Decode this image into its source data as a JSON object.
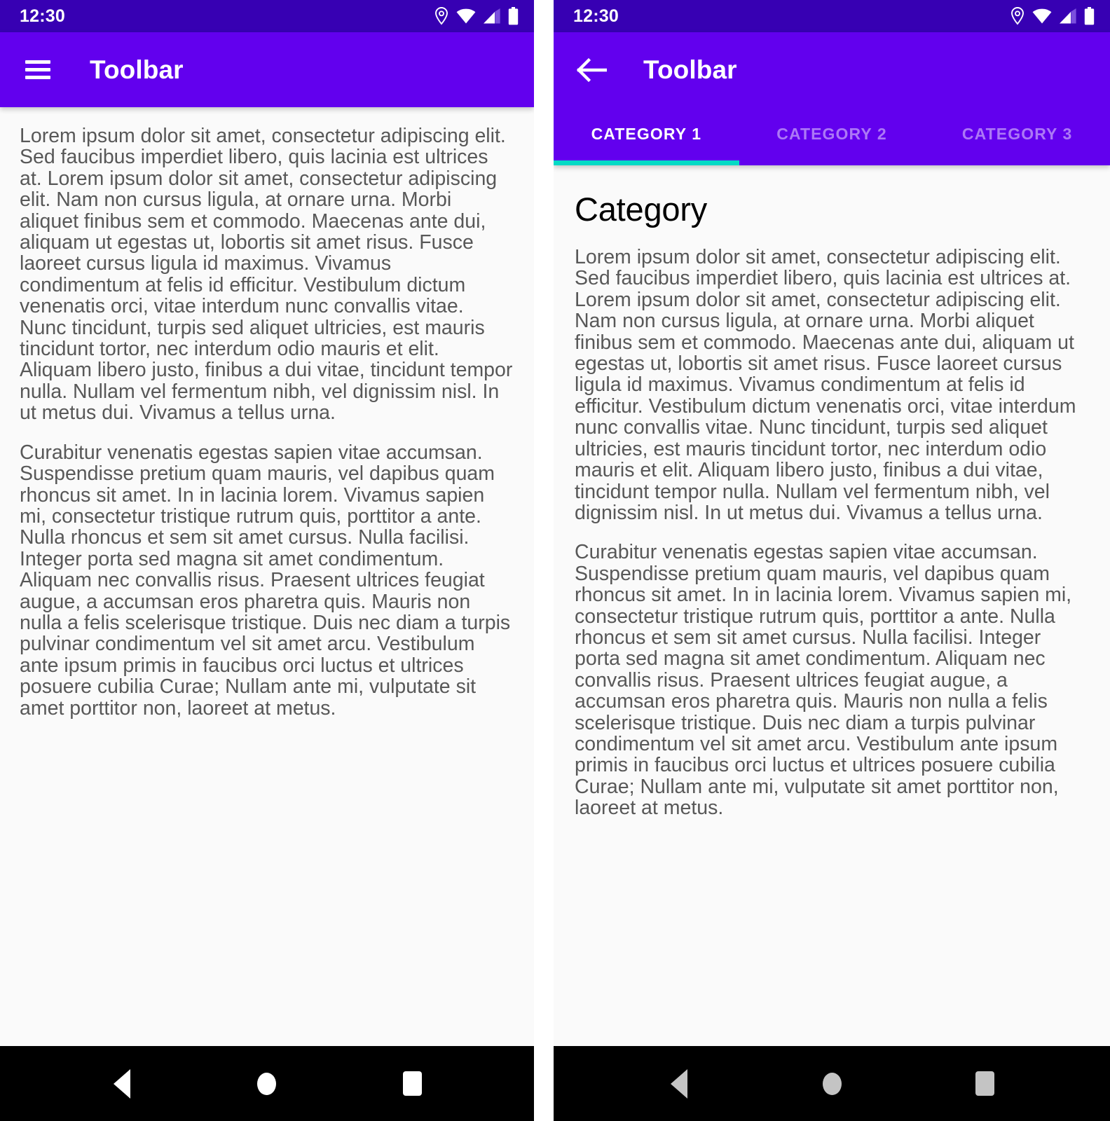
{
  "colors": {
    "status_bar": "#3700B3",
    "toolbar": "#6200EE",
    "tab_indicator": "#03DAC5",
    "content_bg": "#FAFAFA",
    "body_text": "#585858",
    "nav_bar": "#000000"
  },
  "left_screen": {
    "status": {
      "time": "12:30",
      "icons": [
        "location-pin-icon",
        "wifi-icon",
        "cellular-signal-icon",
        "battery-icon"
      ]
    },
    "toolbar": {
      "nav_icon": "hamburger-menu-icon",
      "title": "Toolbar"
    },
    "content": {
      "paragraphs": [
        "Lorem ipsum dolor sit amet, consectetur adipiscing elit. Sed faucibus imperdiet libero, quis lacinia est ultrices at. Lorem ipsum dolor sit amet, consectetur adipiscing elit. Nam non cursus ligula, at ornare urna. Morbi aliquet finibus sem et commodo. Maecenas ante dui, aliquam ut egestas ut, lobortis sit amet risus. Fusce laoreet cursus ligula id maximus. Vivamus condimentum at felis id efficitur. Vestibulum dictum venenatis orci, vitae interdum nunc convallis vitae. Nunc tincidunt, turpis sed aliquet ultricies, est mauris tincidunt tortor, nec interdum odio mauris et elit. Aliquam libero justo, finibus a dui vitae, tincidunt tempor nulla. Nullam vel fermentum nibh, vel dignissim nisl. In ut metus dui. Vivamus a tellus urna.",
        "Curabitur venenatis egestas sapien vitae accumsan. Suspendisse pretium quam mauris, vel dapibus quam rhoncus sit amet. In in lacinia lorem. Vivamus sapien mi, consectetur tristique rutrum quis, porttitor a ante. Nulla rhoncus et sem sit amet cursus. Nulla facilisi. Integer porta sed magna sit amet condimentum. Aliquam nec convallis risus. Praesent ultrices feugiat augue, a accumsan eros pharetra quis. Mauris non nulla a felis scelerisque tristique. Duis nec diam a turpis pulvinar condimentum vel sit amet arcu. Vestibulum ante ipsum primis in faucibus orci luctus et ultrices posuere cubilia Curae; Nullam ante mi, vulputate sit amet porttitor non, laoreet at metus."
      ]
    },
    "navbar": {
      "back_label": "back-button",
      "home_label": "home-button",
      "recents_label": "recents-button"
    }
  },
  "right_screen": {
    "status": {
      "time": "12:30",
      "icons": [
        "location-pin-icon",
        "wifi-icon",
        "cellular-signal-icon",
        "battery-icon"
      ]
    },
    "toolbar": {
      "nav_icon": "back-arrow-icon",
      "title": "Toolbar"
    },
    "tabs": [
      {
        "label": "CATEGORY 1",
        "active": true
      },
      {
        "label": "CATEGORY 2",
        "active": false
      },
      {
        "label": "CATEGORY 3",
        "active": false
      }
    ],
    "content": {
      "heading": "Category",
      "paragraphs": [
        "Lorem ipsum dolor sit amet, consectetur adipiscing elit. Sed faucibus imperdiet libero, quis lacinia est ultrices at. Lorem ipsum dolor sit amet, consectetur adipiscing elit. Nam non cursus ligula, at ornare urna. Morbi aliquet finibus sem et commodo. Maecenas ante dui, aliquam ut egestas ut, lobortis sit amet risus. Fusce laoreet cursus ligula id maximus. Vivamus condimentum at felis id efficitur. Vestibulum dictum venenatis orci, vitae interdum nunc convallis vitae. Nunc tincidunt, turpis sed aliquet ultricies, est mauris tincidunt tortor, nec interdum odio mauris et elit. Aliquam libero justo, finibus a dui vitae, tincidunt tempor nulla. Nullam vel fermentum nibh, vel dignissim nisl. In ut metus dui. Vivamus a tellus urna.",
        "Curabitur venenatis egestas sapien vitae accumsan. Suspendisse pretium quam mauris, vel dapibus quam rhoncus sit amet. In in lacinia lorem. Vivamus sapien mi, consectetur tristique rutrum quis, porttitor a ante. Nulla rhoncus et sem sit amet cursus. Nulla facilisi. Integer porta sed magna sit amet condimentum. Aliquam nec convallis risus. Praesent ultrices feugiat augue, a accumsan eros pharetra quis. Mauris non nulla a felis scelerisque tristique. Duis nec diam a turpis pulvinar condimentum vel sit amet arcu. Vestibulum ante ipsum primis in faucibus orci luctus et ultrices posuere cubilia Curae; Nullam ante mi, vulputate sit amet porttitor non, laoreet at metus."
      ]
    },
    "navbar": {
      "back_label": "back-button",
      "home_label": "home-button",
      "recents_label": "recents-button"
    }
  }
}
